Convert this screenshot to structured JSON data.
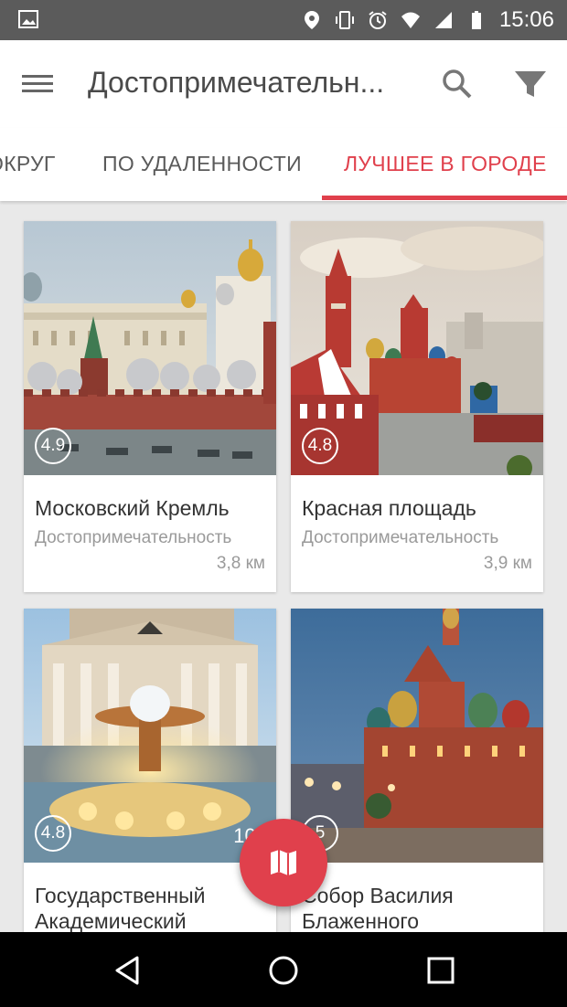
{
  "status_bar": {
    "time": "15:06",
    "icons": [
      "image-icon",
      "location-icon",
      "vibrate-icon",
      "alarm-icon",
      "wifi-icon",
      "signal-icon",
      "battery-icon"
    ]
  },
  "app_bar": {
    "title": "Достопримечательн...",
    "icons": [
      "menu-icon",
      "search-icon",
      "filter-icon"
    ]
  },
  "tabs": [
    {
      "label": "ОКРУГ",
      "active": false
    },
    {
      "label": "ПО УДАЛЕННОСТИ",
      "active": false
    },
    {
      "label": "ЛУЧШЕЕ В ГОРОДЕ",
      "active": true
    }
  ],
  "cards": [
    {
      "name": "Московский Кремль",
      "category": "Достопримечательность",
      "distance": "3,8 км",
      "rating": "4.9"
    },
    {
      "name": "Красная площадь",
      "category": "Достопримечательность",
      "distance": "3,9 км",
      "rating": "4.8"
    },
    {
      "name": "Государственный Академический",
      "category": "",
      "distance": "100",
      "rating": "4.8"
    },
    {
      "name": "Собор Василия Блаженного",
      "category": "",
      "distance": "",
      "rating": "5"
    }
  ],
  "fab": {
    "icon": "map-icon"
  },
  "nav_bar": {
    "icons": [
      "back-icon",
      "home-icon",
      "recents-icon"
    ]
  },
  "colors": {
    "accent": "#e0404c",
    "status_bar": "#5b5b5b",
    "nav_bar": "#000000"
  }
}
